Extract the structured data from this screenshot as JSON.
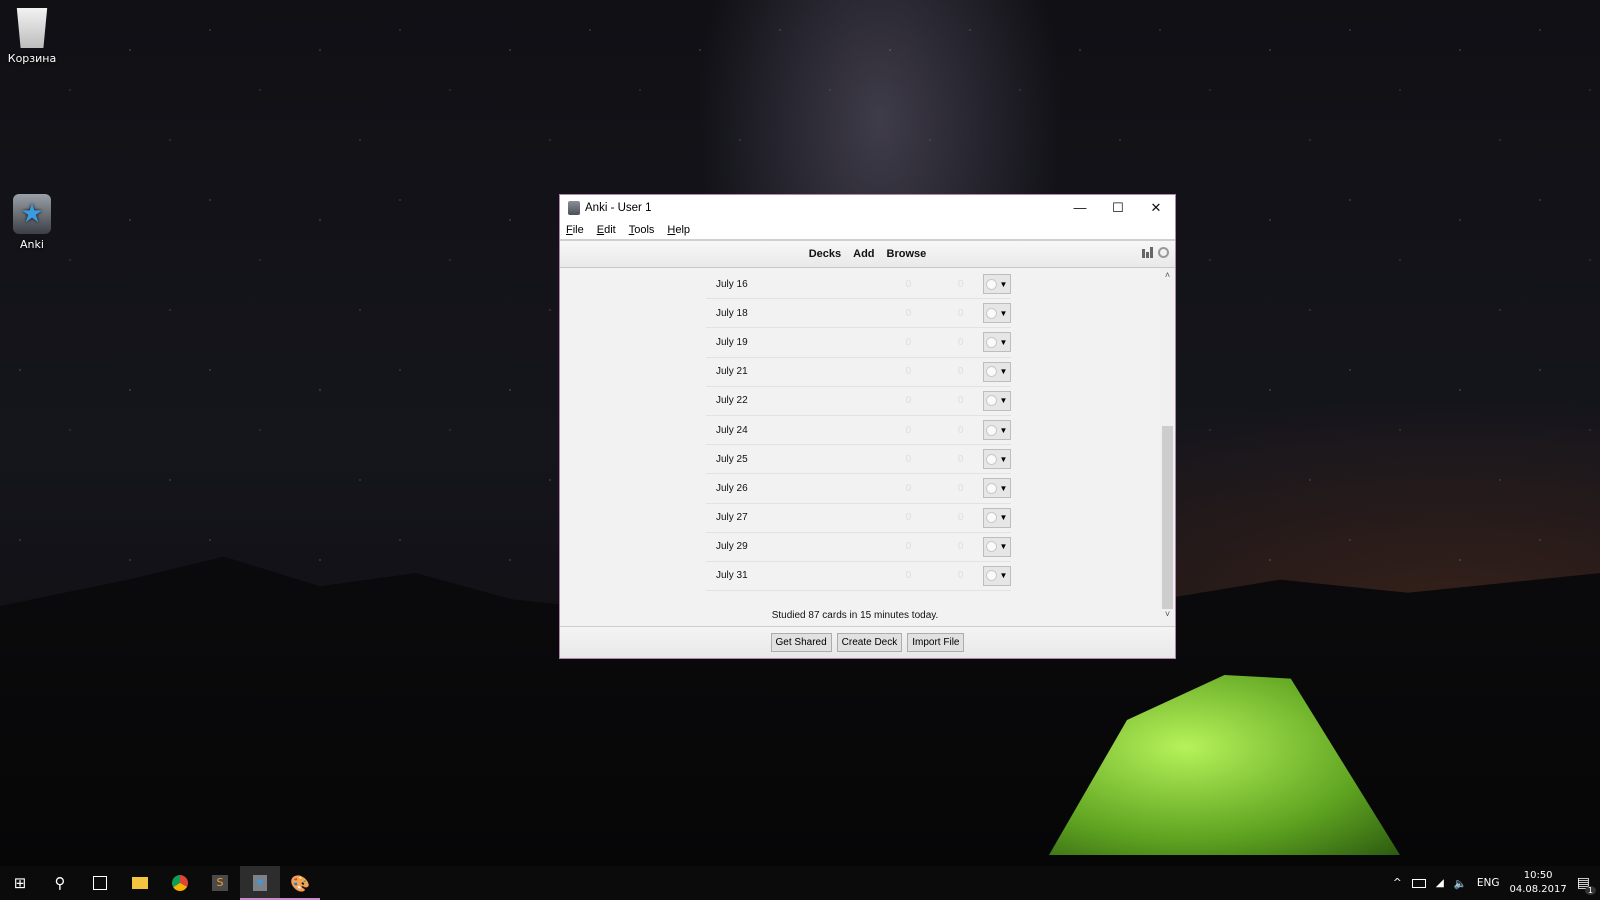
{
  "desktop": {
    "icons": [
      {
        "label": "Корзина",
        "icon": "recycle-bin-icon"
      },
      {
        "label": "Anki",
        "icon": "anki-shortcut-icon"
      }
    ]
  },
  "window": {
    "title": "Anki - User 1",
    "controls": {
      "minimize": "—",
      "maximize": "☐",
      "close": "✕"
    },
    "menu": [
      {
        "label": "File",
        "accel": "F",
        "rest": "ile"
      },
      {
        "label": "Edit",
        "accel": "E",
        "rest": "dit"
      },
      {
        "label": "Tools",
        "accel": "T",
        "rest": "ools"
      },
      {
        "label": "Help",
        "accel": "H",
        "rest": "elp"
      }
    ],
    "toolbar": {
      "links": [
        "Decks",
        "Add",
        "Browse"
      ],
      "icons": [
        "stats-icon",
        "sync-icon"
      ]
    },
    "decks": [
      {
        "name": "July 16",
        "due": "0",
        "new": "0"
      },
      {
        "name": "July 18",
        "due": "0",
        "new": "0"
      },
      {
        "name": "July 19",
        "due": "0",
        "new": "0"
      },
      {
        "name": "July 21",
        "due": "0",
        "new": "0"
      },
      {
        "name": "July 22",
        "due": "0",
        "new": "0"
      },
      {
        "name": "July 24",
        "due": "0",
        "new": "0"
      },
      {
        "name": "July 25",
        "due": "0",
        "new": "0"
      },
      {
        "name": "July 26",
        "due": "0",
        "new": "0"
      },
      {
        "name": "July 27",
        "due": "0",
        "new": "0"
      },
      {
        "name": "July 29",
        "due": "0",
        "new": "0"
      },
      {
        "name": "July 31",
        "due": "0",
        "new": "0"
      }
    ],
    "studied_text": "Studied 87 cards in 15 minutes today.",
    "bottom_buttons": [
      "Get Shared",
      "Create Deck",
      "Import File"
    ],
    "gear_caret": "▼",
    "scroll": {
      "up": "˄",
      "down": "˅"
    }
  },
  "taskbar": {
    "apps": [
      "start",
      "search",
      "task-view",
      "file-explorer",
      "chrome",
      "sublime-text",
      "anki",
      "paint"
    ],
    "tray": {
      "chevron": "^",
      "language": "ENG",
      "time": "10:50",
      "date": "04.08.2017",
      "notifications": "1"
    }
  }
}
